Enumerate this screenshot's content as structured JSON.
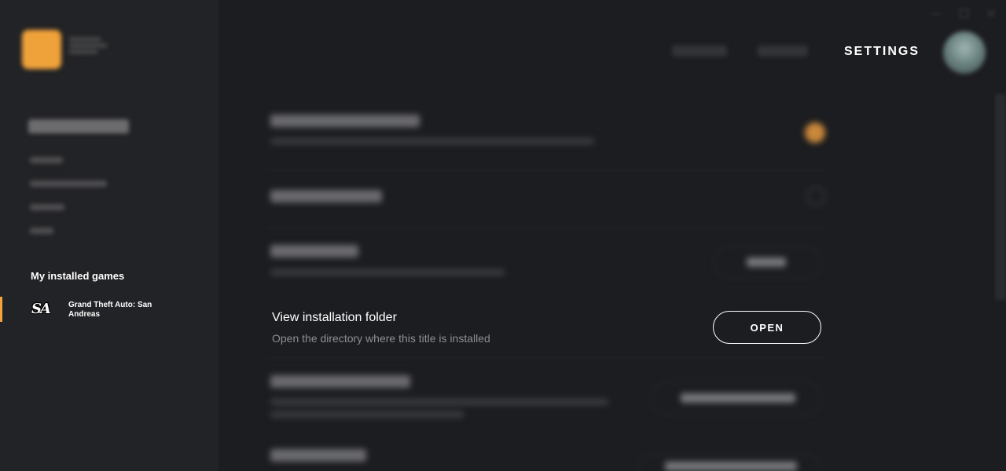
{
  "header": {
    "nav_settings": "SETTINGS"
  },
  "sidebar": {
    "installed_heading": "My installed games",
    "games": [
      {
        "title": "Grand Theft Auto: San Andreas",
        "icon_text": "SA"
      }
    ]
  },
  "main": {
    "focused_row": {
      "title": "View installation folder",
      "description": "Open the directory where this title is installed",
      "button_label": "OPEN"
    }
  },
  "colors": {
    "accent": "#f2a33a",
    "background": "#1c1d21",
    "sidebar": "#222326",
    "muted_text": "#8d8e92"
  }
}
